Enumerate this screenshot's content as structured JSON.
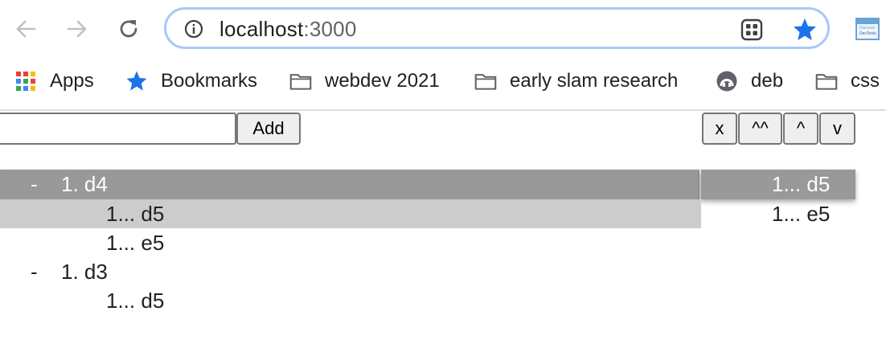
{
  "browser": {
    "url_host": "localhost",
    "url_port": ":3000",
    "extension_text_top": "Discover",
    "extension_text_bottom": "DevTools"
  },
  "bookmarks": [
    {
      "label": "Apps",
      "icon": "apps-grid-icon"
    },
    {
      "label": "Bookmarks",
      "icon": "star-icon"
    },
    {
      "label": "webdev 2021",
      "icon": "folder-icon"
    },
    {
      "label": "early slam research",
      "icon": "folder-icon"
    },
    {
      "label": "deb",
      "icon": "debian-icon"
    },
    {
      "label": "css",
      "icon": "folder-icon"
    }
  ],
  "controls": {
    "input_value": "",
    "add_label": "Add",
    "delete_label": "x",
    "top_label": "^^",
    "up_label": "^",
    "down_label": "v"
  },
  "tree": {
    "rows": [
      {
        "dash": "-",
        "text": "1. d4",
        "state": "selected"
      },
      {
        "dash": "",
        "text": "1... d5",
        "state": "hovered"
      },
      {
        "dash": "",
        "text": "1... e5",
        "state": "normal"
      },
      {
        "dash": "-",
        "text": "1. d3",
        "state": "normal"
      },
      {
        "dash": "",
        "text": "1... d5",
        "state": "normal"
      }
    ],
    "side": [
      {
        "text": "1... d5",
        "state": "selected"
      },
      {
        "text": "1... e5",
        "state": "normal"
      }
    ]
  },
  "colors": {
    "selected_bg": "#999999",
    "hover_bg": "#cccccc",
    "omnibox_border": "#a8c7fa",
    "accent": "#1a73e8"
  }
}
